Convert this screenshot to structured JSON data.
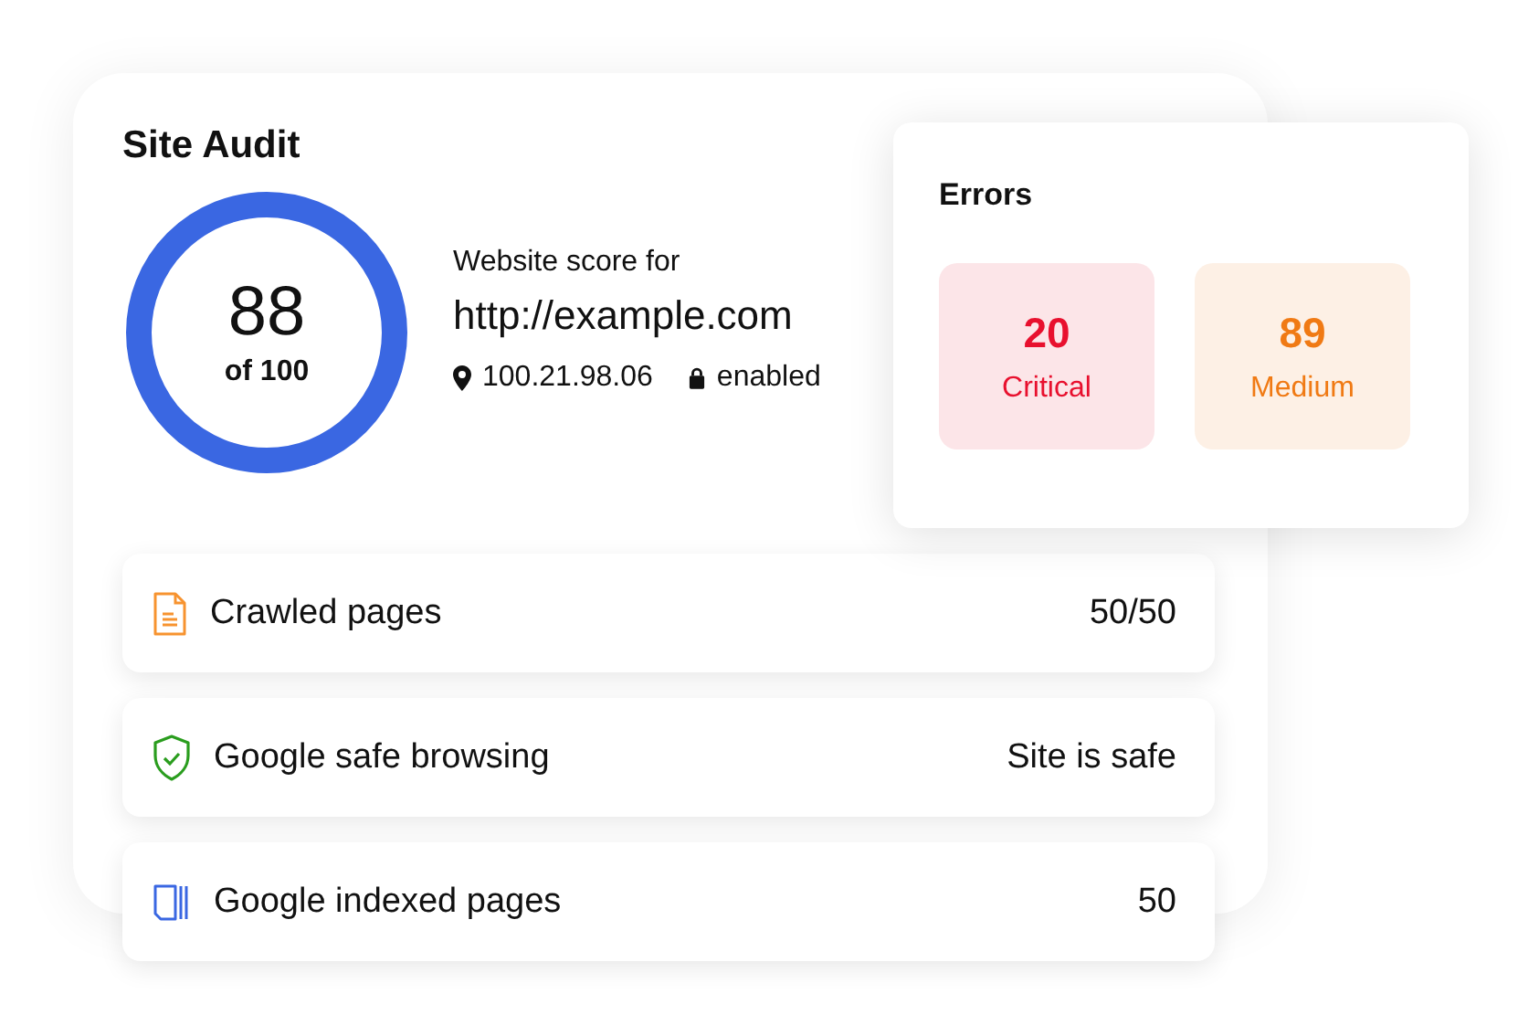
{
  "audit": {
    "title": "Site Audit",
    "score": "88",
    "score_caption": "of 100",
    "score_label": "Website score for",
    "url": "http://example.com",
    "ip": "100.21.98.06",
    "ssl": "enabled"
  },
  "errors": {
    "title": "Errors",
    "items": [
      {
        "count": "20",
        "label": "Critical",
        "color": "#e8102e"
      },
      {
        "count": "89",
        "label": "Medium",
        "color": "#f07a14"
      }
    ]
  },
  "metrics": [
    {
      "kind": "document",
      "label": "Crawled pages",
      "value": "50/50"
    },
    {
      "kind": "shield",
      "label": "Google safe browsing",
      "value": "Site is safe"
    },
    {
      "kind": "pages",
      "label": "Google indexed pages",
      "value": "50"
    }
  ]
}
